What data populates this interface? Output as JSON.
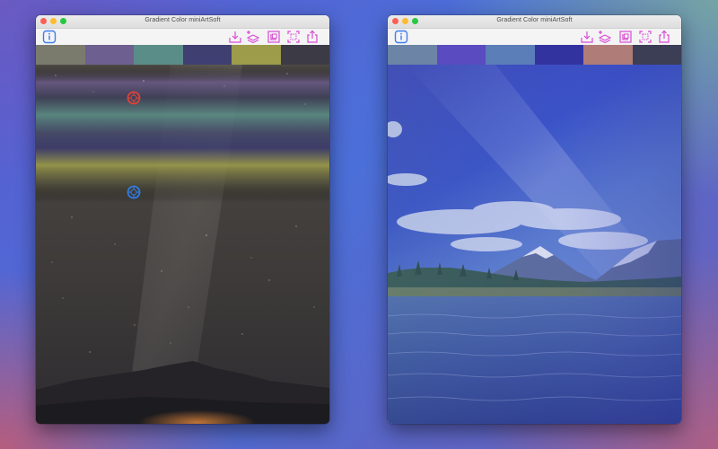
{
  "windows": [
    {
      "id": "left",
      "title": "Gradient Color miniArtSoft",
      "swatches": [
        "#7b7b6d",
        "#6d5f8f",
        "#5b8d88",
        "#3f3f72",
        "#9d9c4a",
        "#3c3b45"
      ],
      "toolbar_icons": [
        "info-icon",
        "import-icon",
        "add-layers-icon",
        "crop-icon",
        "fit-screen-icon",
        "share-icon"
      ],
      "handles": [
        {
          "name": "red-color-point-icon",
          "color": "#e0413a"
        },
        {
          "name": "blue-color-point-icon",
          "color": "#2f7be6"
        }
      ]
    },
    {
      "id": "right",
      "title": "Gradient Color miniArtSoft",
      "swatches": [
        "#6c84a5",
        "#5a4cc0",
        "#5b7db8",
        "#3333a0",
        "#b07c78",
        "#3c3e56"
      ],
      "toolbar_icons": [
        "info-icon",
        "import-icon",
        "add-layers-icon",
        "crop-icon",
        "fit-screen-icon",
        "share-icon"
      ]
    }
  ],
  "colors": {
    "accent_blue": "#3d7df2",
    "toolbar_magenta": "#d94bd6"
  }
}
